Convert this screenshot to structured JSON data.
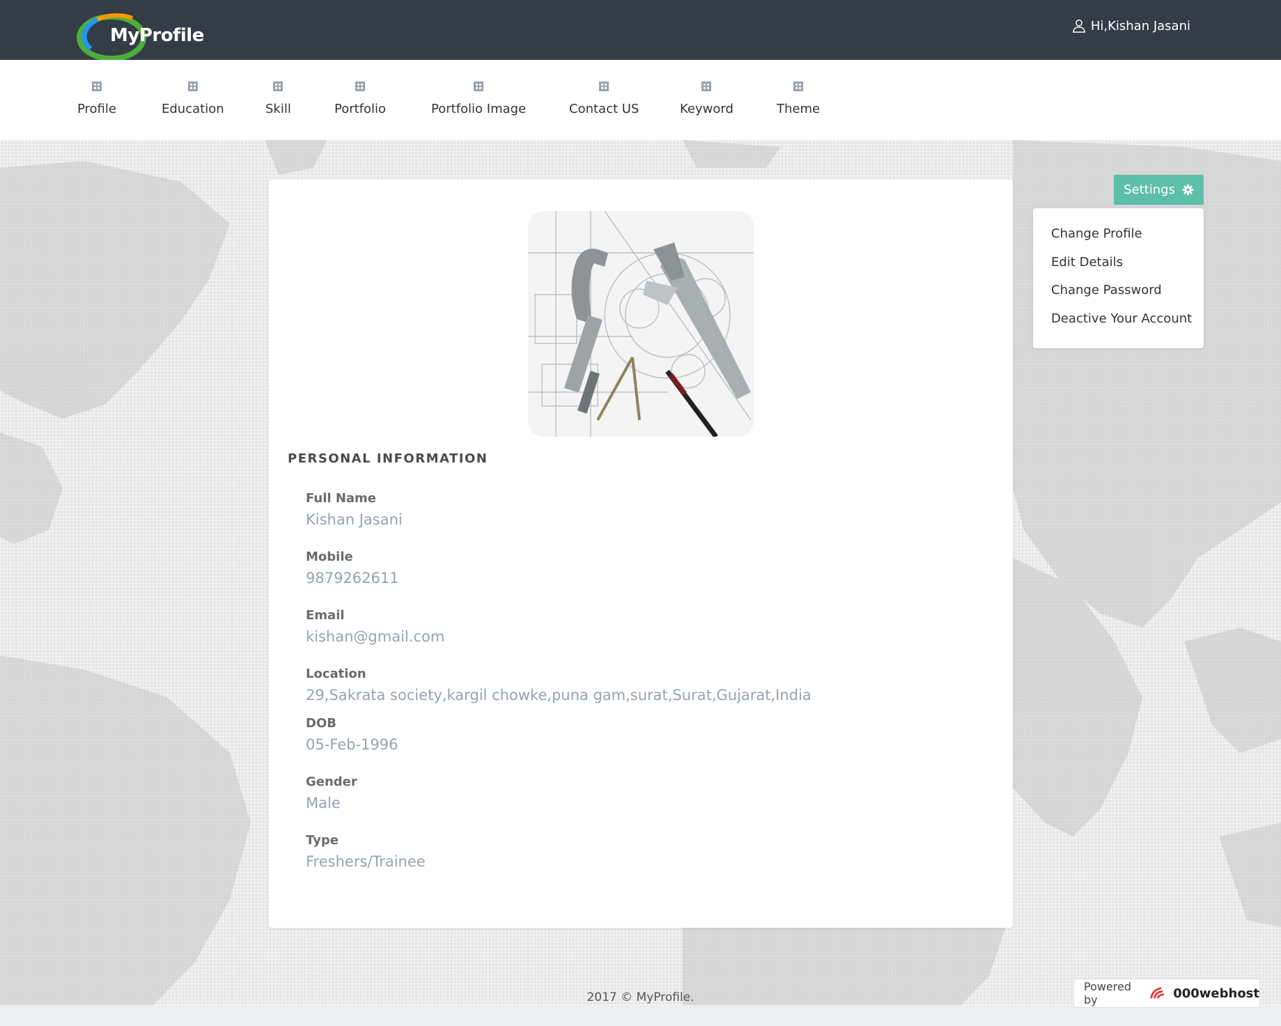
{
  "header": {
    "logo_text": "MyProfile",
    "greeting": "Hi,Kishan Jasani"
  },
  "nav": {
    "items": [
      {
        "label": "Profile"
      },
      {
        "label": "Education"
      },
      {
        "label": "Skill"
      },
      {
        "label": "Portfolio"
      },
      {
        "label": "Portfolio Image"
      },
      {
        "label": "Contact US"
      },
      {
        "label": "Keyword"
      },
      {
        "label": "Theme"
      }
    ]
  },
  "profile": {
    "section_title": "PERSONAL INFORMATION",
    "fields": [
      {
        "label": "Full Name",
        "value": "Kishan Jasani"
      },
      {
        "label": "Mobile",
        "value": "9879262611"
      },
      {
        "label": "Email",
        "value": "kishan@gmail.com"
      },
      {
        "label": "Location",
        "value": "29,Sakrata society,kargil chowke,puna gam,surat,Surat,Gujarat,India"
      },
      {
        "label": "DOB",
        "value": "05-Feb-1996"
      },
      {
        "label": "Gender",
        "value": "Male"
      },
      {
        "label": "Type",
        "value": "Freshers/Trainee"
      }
    ]
  },
  "settings": {
    "button_label": "Settings",
    "menu": [
      {
        "label": "Change Profile"
      },
      {
        "label": "Edit Details"
      },
      {
        "label": "Change Password"
      },
      {
        "label": "Deactive Your Account"
      }
    ]
  },
  "footer": {
    "copyright": "2017 © MyProfile.",
    "powered_by": "Powered by",
    "host": "000webhost"
  },
  "colors": {
    "topbar": "#343d46",
    "accent": "#5dbfa8",
    "value_text": "#98a2ad"
  },
  "icons": {
    "user": "user-icon",
    "nav": "plus-square-icon",
    "settings": "gear-icon",
    "host_logo": "webhost-logo-icon"
  }
}
